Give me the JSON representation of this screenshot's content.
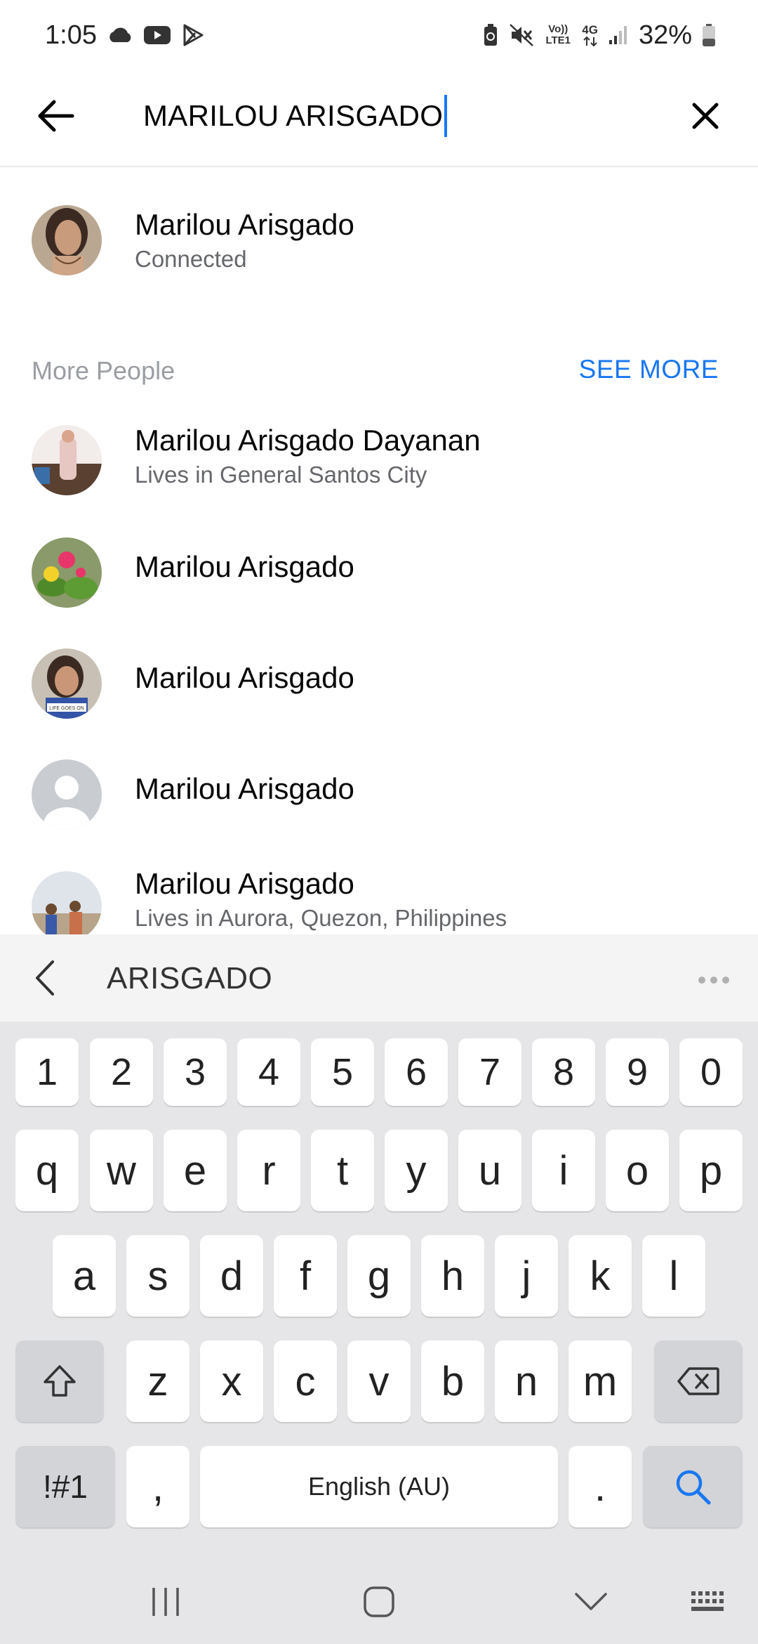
{
  "status_bar": {
    "time": "1:05",
    "battery_percent": "32%",
    "network_volte": "Vo)) LTE1",
    "network_gen": "4G",
    "icons": [
      "cloud-icon",
      "youtube-icon",
      "play-store-icon",
      "battery-saver-icon",
      "mute-icon",
      "signal-icon",
      "battery-icon"
    ]
  },
  "search": {
    "query": "MARILOU ARISGADO",
    "back_icon": "arrow-left-icon",
    "clear_icon": "close-icon"
  },
  "connected": {
    "name": "Marilou Arisgado",
    "subtitle": "Connected"
  },
  "more_people": {
    "title": "More People",
    "see_more": "SEE MORE",
    "items": [
      {
        "name": "Marilou Arisgado Dayanan",
        "subtitle": "Lives in General Santos City"
      },
      {
        "name": "Marilou Arisgado",
        "subtitle": ""
      },
      {
        "name": "Marilou Arisgado",
        "subtitle": "",
        "avatar_caption": "LIFE GOES ON"
      },
      {
        "name": "Marilou Arisgado",
        "subtitle": ""
      },
      {
        "name": "Marilou Arisgado",
        "subtitle": "Lives in Aurora, Quezon, Philippines"
      }
    ]
  },
  "keyboard": {
    "suggestion": "ARISGADO",
    "row_numbers": [
      "1",
      "2",
      "3",
      "4",
      "5",
      "6",
      "7",
      "8",
      "9",
      "0"
    ],
    "row_1": [
      "q",
      "w",
      "e",
      "r",
      "t",
      "y",
      "u",
      "i",
      "o",
      "p"
    ],
    "row_2": [
      "a",
      "s",
      "d",
      "f",
      "g",
      "h",
      "j",
      "k",
      "l"
    ],
    "row_3": [
      "z",
      "x",
      "c",
      "v",
      "b",
      "n",
      "m"
    ],
    "symbols_key": "!#1",
    "comma_key": ",",
    "space_label": "English (AU)",
    "period_key": ".",
    "action_icon": "search-icon"
  },
  "nav_bar": {
    "icons": [
      "recent-apps-icon",
      "home-icon",
      "back-chevron-icon",
      "keyboard-icon"
    ]
  },
  "colors": {
    "accent": "#1877f2",
    "secondary_text": "#65676b",
    "keyboard_bg": "#e6e6e8"
  }
}
